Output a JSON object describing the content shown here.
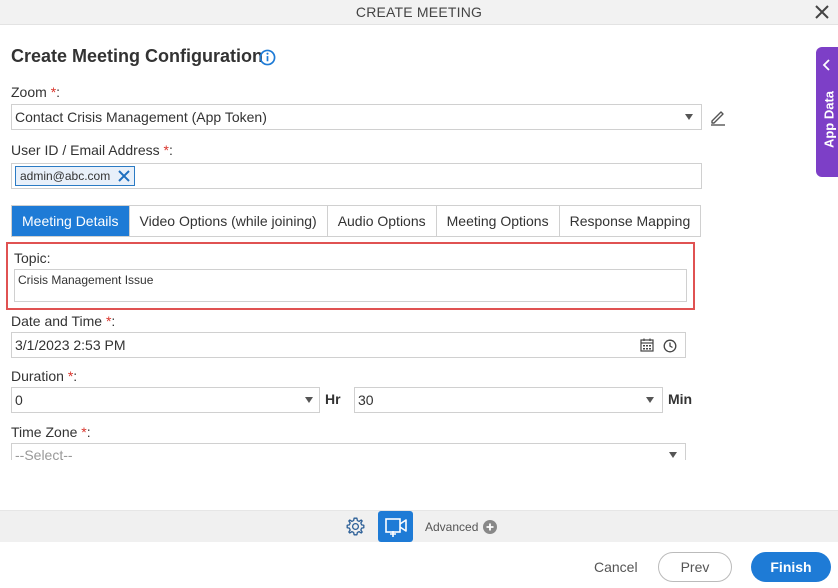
{
  "window": {
    "title": "CREATE MEETING"
  },
  "page": {
    "heading": "Create Meeting Configuration"
  },
  "zoom": {
    "label": "Zoom",
    "required": "*",
    "colon": ":",
    "value": "Contact Crisis Management (App Token)"
  },
  "user": {
    "label": "User ID / Email Address",
    "required": "*",
    "colon": ":",
    "chip": "admin@abc.com"
  },
  "tabs": [
    {
      "label": "Meeting Details"
    },
    {
      "label": "Video Options (while joining)"
    },
    {
      "label": "Audio Options"
    },
    {
      "label": "Meeting Options"
    },
    {
      "label": "Response Mapping"
    }
  ],
  "topic": {
    "label": "Topic:",
    "value": "Crisis Management Issue"
  },
  "datetime": {
    "label": "Date and Time",
    "required": "*",
    "colon": ":",
    "value": "3/1/2023 2:53 PM"
  },
  "duration": {
    "label": "Duration",
    "required": "*",
    "colon": ":",
    "hours": "0",
    "hr_unit": "Hr",
    "minutes": "30",
    "min_unit": "Min"
  },
  "timezone": {
    "label": "Time Zone",
    "required": "*",
    "colon": ":",
    "placeholder": "--Select--"
  },
  "footer": {
    "advanced": "Advanced",
    "cancel": "Cancel",
    "prev": "Prev",
    "finish": "Finish"
  },
  "sidepanel": {
    "label": "App Data"
  },
  "colors": {
    "primary": "#1e7bd6",
    "highlight": "#e05252",
    "side_panel": "#7d3fc7",
    "required": "#d9342b"
  }
}
